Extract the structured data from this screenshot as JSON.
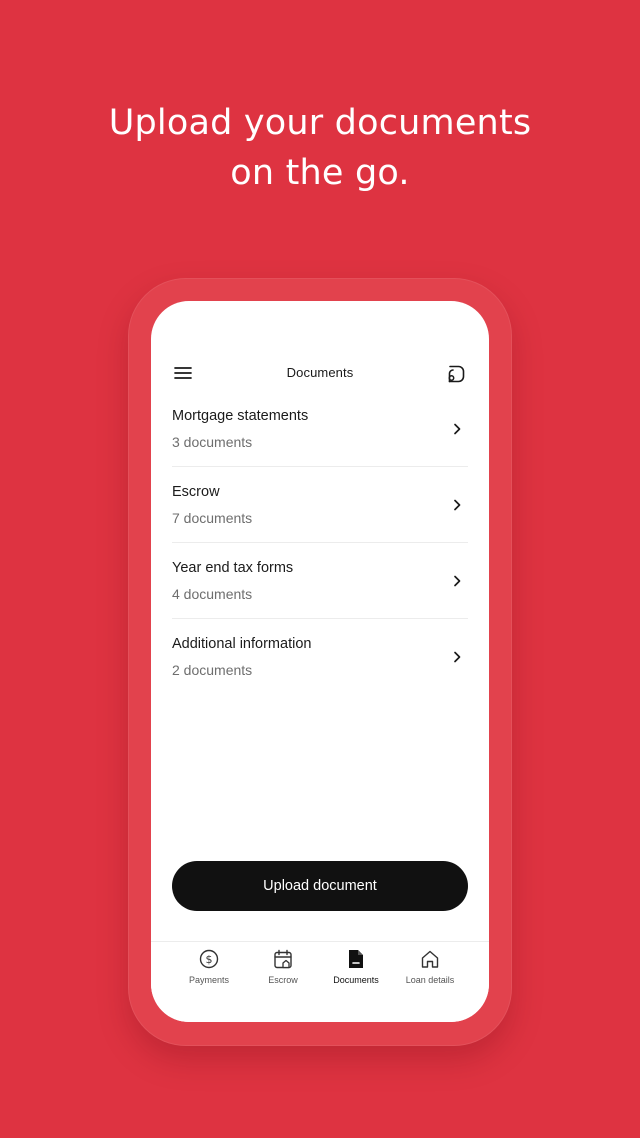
{
  "promo": {
    "headline_line1": "Upload your documents",
    "headline_line2": "on the go."
  },
  "colors": {
    "background": "#de3341",
    "button": "#111111",
    "screen": "#ffffff"
  },
  "app": {
    "title": "Documents",
    "menu_icon": "hamburger-menu-icon",
    "chat_icon": "chat-bubble-icon"
  },
  "documents": [
    {
      "name": "Mortgage statements",
      "count": "3 documents"
    },
    {
      "name": "Escrow",
      "count": "7 documents"
    },
    {
      "name": "Year end tax forms",
      "count": "4 documents"
    },
    {
      "name": "Additional information",
      "count": "2 documents"
    }
  ],
  "upload_button": "Upload document",
  "nav": [
    {
      "label": "Payments",
      "icon": "dollar-circle-icon",
      "active": false
    },
    {
      "label": "Escrow",
      "icon": "calendar-home-icon",
      "active": false
    },
    {
      "label": "Documents",
      "icon": "document-icon",
      "active": true
    },
    {
      "label": "Loan details",
      "icon": "home-icon",
      "active": false
    }
  ]
}
